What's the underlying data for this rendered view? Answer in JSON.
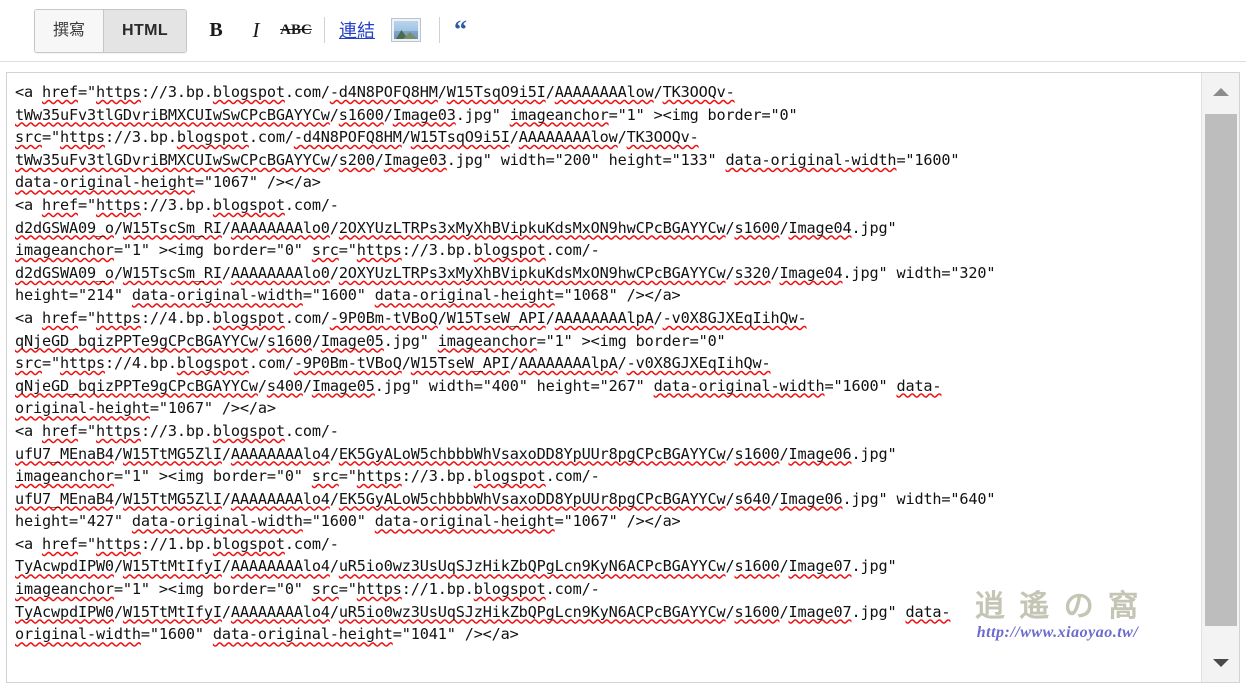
{
  "toolbar": {
    "tabs": [
      {
        "label": "撰寫",
        "state": "inactive",
        "name": "tab-compose"
      },
      {
        "label": "HTML",
        "state": "active",
        "name": "tab-html"
      }
    ],
    "bold_label": "B",
    "italic_label": "I",
    "strike_label": "ABC",
    "link_label": "連結",
    "image_icon": "image-icon",
    "quote_label": "“"
  },
  "editor": {
    "lines": [
      "<a href=\"https://3.bp.blogspot.com/-d4N8POFQ8HM/W15TsqO9i5I/AAAAAAAAlow/TK3OOQv-",
      "tWw35uFv3tlGDvriBMXCUIwSwCPcBGAYYCw/s1600/Image03.jpg\" imageanchor=\"1\" ><img border=\"0\"",
      "src=\"https://3.bp.blogspot.com/-d4N8POFQ8HM/W15TsqO9i5I/AAAAAAAAlow/TK3OOQv-",
      "tWw35uFv3tlGDvriBMXCUIwSwCPcBGAYYCw/s200/Image03.jpg\" width=\"200\" height=\"133\" data-original-width=\"1600\"",
      "data-original-height=\"1067\" /></a>",
      "<a href=\"https://3.bp.blogspot.com/-",
      "d2dGSWA09_o/W15TscSm_RI/AAAAAAAAlo0/2OXYUzLTRPs3xMyXhBVipkuKdsMxON9hwCPcBGAYYCw/s1600/Image04.jpg\"",
      "imageanchor=\"1\" ><img border=\"0\" src=\"https://3.bp.blogspot.com/-",
      "d2dGSWA09_o/W15TscSm_RI/AAAAAAAAlo0/2OXYUzLTRPs3xMyXhBVipkuKdsMxON9hwCPcBGAYYCw/s320/Image04.jpg\" width=\"320\"",
      "height=\"214\" data-original-width=\"1600\" data-original-height=\"1068\" /></a>",
      "<a href=\"https://4.bp.blogspot.com/-9P0Bm-tVBoQ/W15TseW_API/AAAAAAAAlpA/-v0X8GJXEqIihQw-",
      "qNjeGD_bqizPPTe9gCPcBGAYYCw/s1600/Image05.jpg\" imageanchor=\"1\" ><img border=\"0\"",
      "src=\"https://4.bp.blogspot.com/-9P0Bm-tVBoQ/W15TseW_API/AAAAAAAAlpA/-v0X8GJXEqIihQw-",
      "qNjeGD_bqizPPTe9gCPcBGAYYCw/s400/Image05.jpg\" width=\"400\" height=\"267\" data-original-width=\"1600\" data-",
      "original-height=\"1067\" /></a>",
      "<a href=\"https://3.bp.blogspot.com/-",
      "ufU7_MEnaB4/W15TtMG5ZlI/AAAAAAAAlo4/EK5GyALoW5chbbbWhVsaxoDD8YpUUr8pgCPcBGAYYCw/s1600/Image06.jpg\"",
      "imageanchor=\"1\" ><img border=\"0\" src=\"https://3.bp.blogspot.com/-",
      "ufU7_MEnaB4/W15TtMG5ZlI/AAAAAAAAlo4/EK5GyALoW5chbbbWhVsaxoDD8YpUUr8pgCPcBGAYYCw/s640/Image06.jpg\" width=\"640\"",
      "height=\"427\" data-original-width=\"1600\" data-original-height=\"1067\" /></a>",
      "<a href=\"https://1.bp.blogspot.com/-",
      "TyAcwpdIPW0/W15TtMtIfyI/AAAAAAAAlo4/uR5io0wz3UsUqSJzHikZbQPgLcn9KyN6ACPcBGAYYCw/s1600/Image07.jpg\"",
      "imageanchor=\"1\" ><img border=\"0\" src=\"https://1.bp.blogspot.com/-",
      "TyAcwpdIPW0/W15TtMtIfyI/AAAAAAAAlo4/uR5io0wz3UsUqSJzHikZbQPgLcn9KyN6ACPcBGAYYCw/s1600/Image07.jpg\" data-",
      "original-width=\"1600\" data-original-height=\"1041\" /></a>"
    ],
    "highlights": [
      {
        "text": "width=\"200\"",
        "line": 4
      },
      {
        "text": "width=\"320\"",
        "line": 9
      },
      {
        "text": "width=\"400\"",
        "line": 14
      },
      {
        "text": "width=\"640\"",
        "line": 19
      },
      {
        "text": "data-original-width=\"1600\" data-original-height=\"1041\"",
        "line": 24
      }
    ],
    "selection_color": "#2a7bea",
    "marker_color": "#ec1c24",
    "spellcheck_color": "#ee1111"
  },
  "scrollbar": {
    "up_arrow": "scroll-up-arrow",
    "down_arrow": "scroll-down-arrow",
    "thumb": "scroll-thumb"
  },
  "watermark": {
    "glyphs": "逍 遙 の 窩",
    "url": "http://www.xiaoyao.tw/"
  }
}
